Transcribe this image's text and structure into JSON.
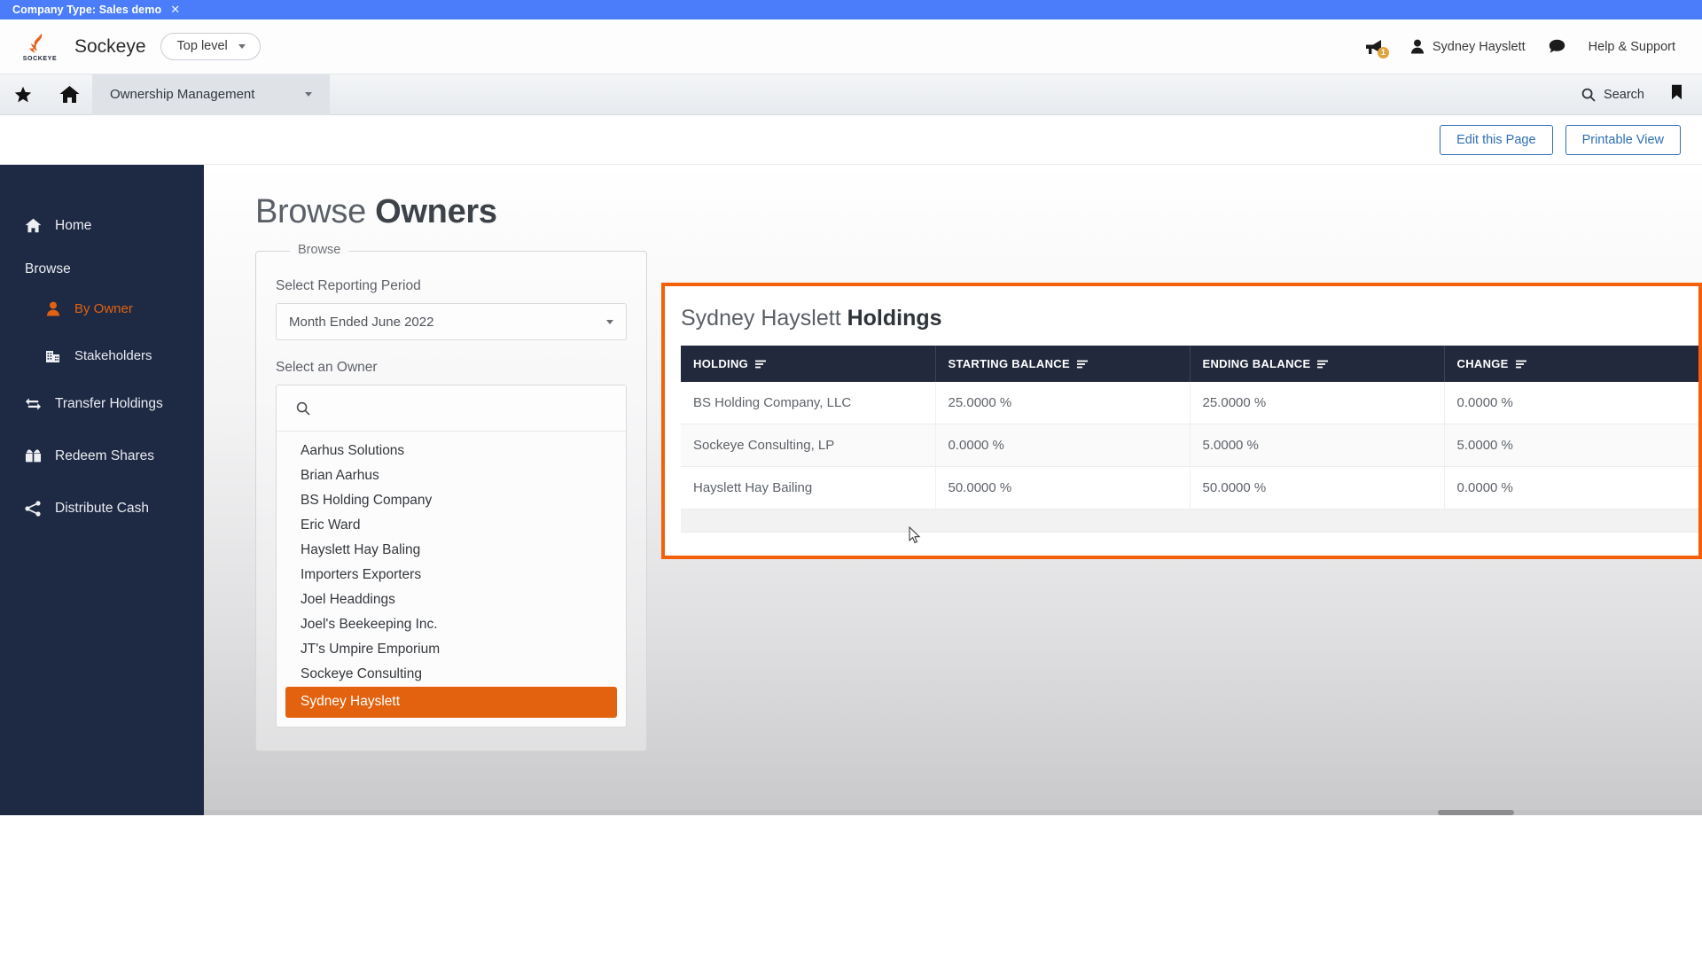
{
  "banner": {
    "text": "Company Type: Sales demo",
    "close_icon": "close-x-icon",
    "color": "#4b7dfb"
  },
  "brand": {
    "logo_icon": "sockeye-fish-logo",
    "logo_word": "SOCKEYE",
    "name": "Sockeye",
    "level_selector": "Top level",
    "level_caret_icon": "chevron-down-icon"
  },
  "header": {
    "megaphone_icon": "megaphone-icon",
    "megaphone_badge": "1",
    "user_icon": "person-icon",
    "user_name": "Sydney Hayslett",
    "chat_icon": "speech-bubble-icon",
    "help_label": "Help & Support"
  },
  "module_bar": {
    "star_icon": "star-icon",
    "home_icon": "home-icon",
    "active_module": "Ownership Management",
    "module_caret_icon": "chevron-down-icon",
    "search_icon": "search-icon",
    "search_label": "Search",
    "bookmark_icon": "bookmark-icon"
  },
  "actions": {
    "edit_page": "Edit this Page",
    "printable_view": "Printable View",
    "accent": "#2f6fb5"
  },
  "sidebar": {
    "background": "#1e2a44",
    "active_color": "#e2620f",
    "items": [
      {
        "label": "Home",
        "icon": "home-icon",
        "type": "link",
        "active": false
      },
      {
        "label": "Browse",
        "icon": "",
        "type": "section",
        "active": false
      },
      {
        "label": "By Owner",
        "icon": "person-icon",
        "type": "sub",
        "active": true
      },
      {
        "label": "Stakeholders",
        "icon": "building-icon",
        "type": "sub",
        "active": false
      },
      {
        "label": "Transfer Holdings",
        "icon": "transfer-arrows-icon",
        "type": "link",
        "active": false
      },
      {
        "label": "Redeem Shares",
        "icon": "ticket-icon",
        "type": "link",
        "active": false
      },
      {
        "label": "Distribute Cash",
        "icon": "share-nodes-icon",
        "type": "link",
        "active": false
      }
    ]
  },
  "page": {
    "title_light": "Browse ",
    "title_bold": "Owners"
  },
  "browse_panel": {
    "legend": "Browse",
    "reporting_period_label": "Select Reporting Period",
    "reporting_period_value": "Month Ended June 2022",
    "reporting_period_caret_icon": "chevron-down-icon",
    "owner_label": "Select an Owner",
    "owner_search_icon": "search-icon",
    "owner_search_value": "",
    "owner_search_placeholder": "",
    "owners": [
      "Aarhus Solutions",
      "Brian Aarhus",
      "BS Holding Company",
      "Eric Ward",
      "Hayslett Hay Baling",
      "Importers Exporters",
      "Joel Headdings",
      "Joel's Beekeeping Inc.",
      "JT's Umpire Emporium",
      "Sockeye Consulting",
      "Sydney Hayslett"
    ],
    "selected_owner": "Sydney Hayslett",
    "selected_color": "#e2620f"
  },
  "holdings": {
    "highlight_color": "#f4600a",
    "title_light": "Sydney Hayslett ",
    "title_bold": "Holdings",
    "sort_icon": "sort-filter-icon",
    "columns": [
      "HOLDING",
      "STARTING BALANCE",
      "ENDING BALANCE",
      "CHANGE"
    ],
    "rows": [
      {
        "holding": "BS Holding Company, LLC",
        "starting_balance": "25.0000 %",
        "ending_balance": "25.0000 %",
        "change": "0.0000 %",
        "change_positive": false
      },
      {
        "holding": "Sockeye Consulting, LP",
        "starting_balance": "0.0000 %",
        "ending_balance": "5.0000 %",
        "change": "5.0000 %",
        "change_positive": true
      },
      {
        "holding": "Hayslett Hay Bailing",
        "starting_balance": "50.0000 %",
        "ending_balance": "50.0000 %",
        "change": "0.0000 %",
        "change_positive": false
      }
    ],
    "positive_color": "#4aa34a"
  }
}
